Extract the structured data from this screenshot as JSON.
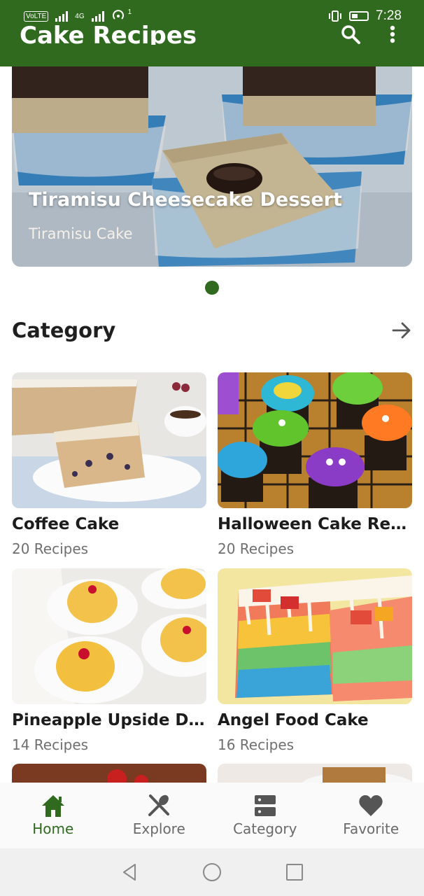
{
  "status_bar": {
    "network_badge": "VoLTE",
    "network_type": "4G",
    "notification_count": "1",
    "time": "7:28"
  },
  "app_bar": {
    "title": "Cake Recipes",
    "icons": [
      "search-icon",
      "more-vert-icon"
    ]
  },
  "banner": {
    "title": "Tiramisu Cheesecake Dessert",
    "subtitle": "Tiramisu Cake",
    "page_indicator": {
      "current": 1,
      "total": 1
    }
  },
  "category_section": {
    "title": "Category",
    "icon": "arrow-forward-icon"
  },
  "categories": [
    {
      "name": "Coffee Cake",
      "count": "20 Recipes"
    },
    {
      "name": "Halloween Cake Recipes",
      "count": "20 Recipes"
    },
    {
      "name": "Pineapple Upside Down Cake",
      "count": "14 Recipes"
    },
    {
      "name": "Angel Food Cake",
      "count": "16 Recipes"
    }
  ],
  "bottom_nav": {
    "items": [
      {
        "label": "Home",
        "icon": "home-icon",
        "active": true
      },
      {
        "label": "Explore",
        "icon": "utensils-icon",
        "active": false
      },
      {
        "label": "Category",
        "icon": "category-icon",
        "active": false
      },
      {
        "label": "Favorite",
        "icon": "heart-icon",
        "active": false
      }
    ]
  },
  "colors": {
    "primary": "#2f6a1e",
    "text": "#1f1f1f",
    "muted": "#6f6f6f"
  }
}
